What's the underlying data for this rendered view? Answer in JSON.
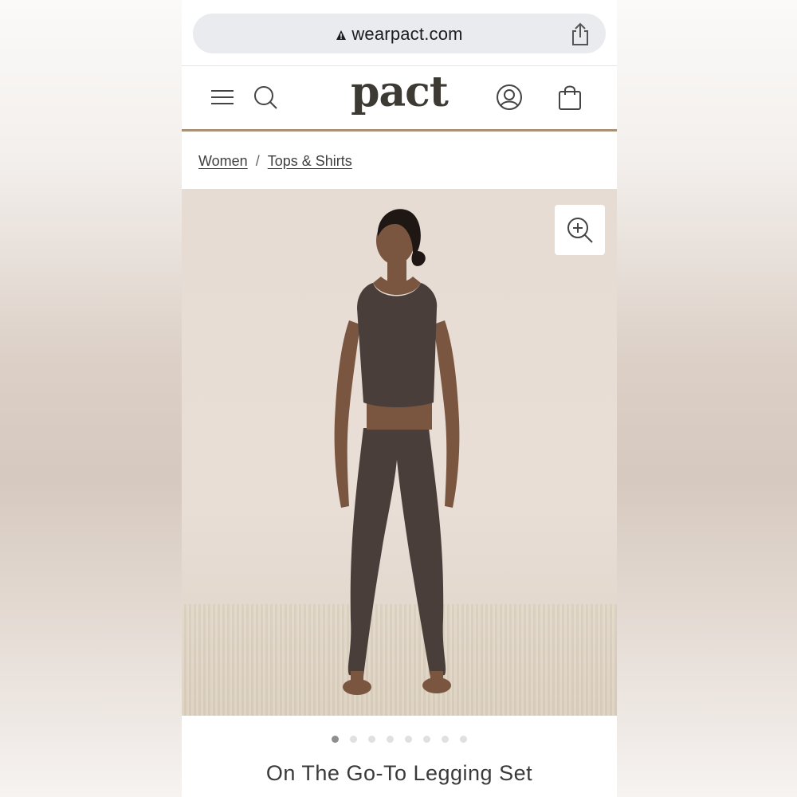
{
  "browser": {
    "url": "wearpact.com",
    "icons": {
      "lock": "lock-icon",
      "share": "share-icon"
    }
  },
  "header": {
    "logo": "pact",
    "icons": [
      "menu-icon",
      "search-icon",
      "account-icon",
      "shopping-bag-icon"
    ]
  },
  "breadcrumb": {
    "items": [
      "Women",
      "Tops & Shirts"
    ],
    "separator": "/"
  },
  "product": {
    "image_alt_icon": "zoom-in-icon",
    "title": "On The Go-To Legging Set",
    "carousel": {
      "count": 8,
      "active_index": 0
    }
  },
  "colors": {
    "accent": "#a89177",
    "logo": "#3d3a34",
    "outfit": "#4a3e3a"
  }
}
